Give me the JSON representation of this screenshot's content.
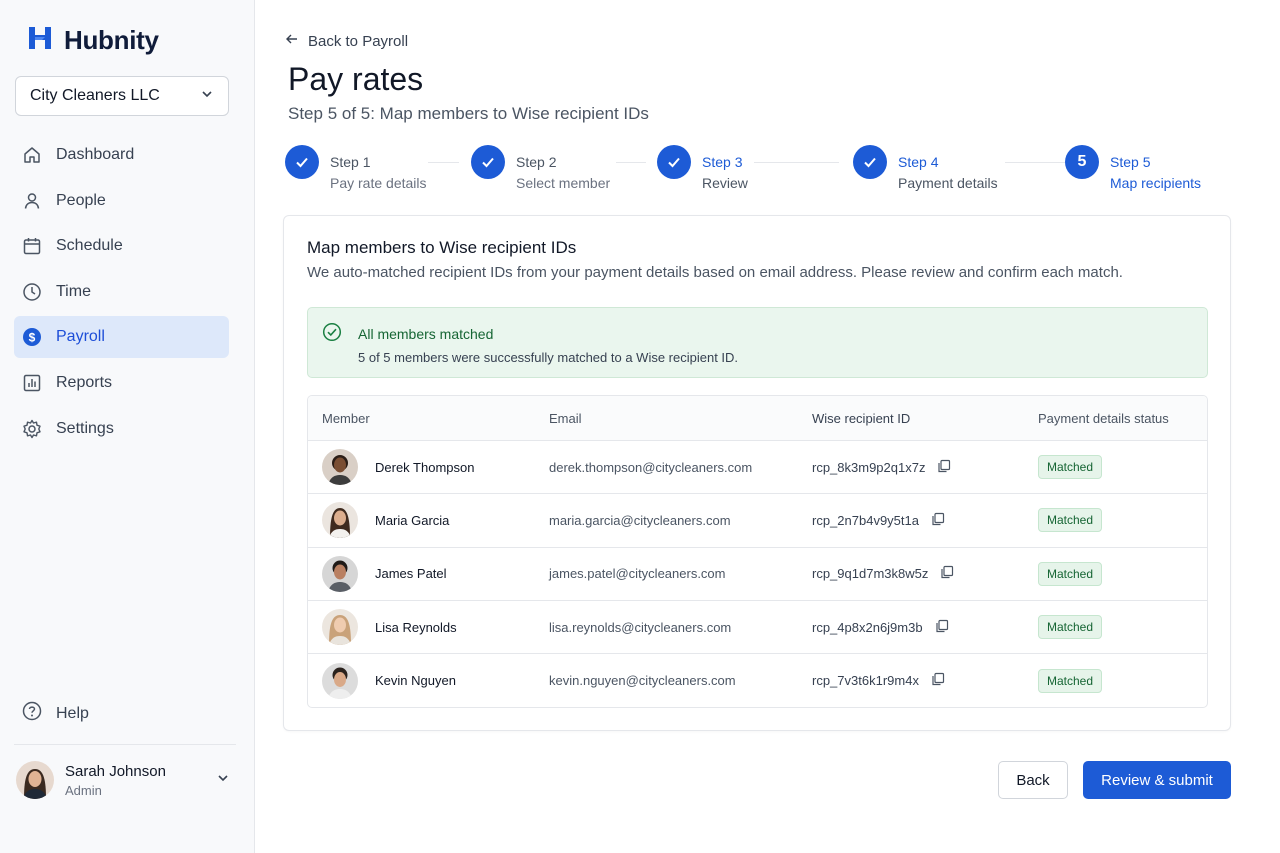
{
  "app": {
    "name": "Hubnity",
    "organization": "City Cleaners LLC"
  },
  "sidebar": {
    "items": [
      {
        "label": "Dashboard",
        "icon": "home-icon"
      },
      {
        "label": "People",
        "icon": "person-icon"
      },
      {
        "label": "Schedule",
        "icon": "calendar-icon"
      },
      {
        "label": "Time",
        "icon": "clock-icon"
      },
      {
        "label": "Payroll",
        "icon": "dollar-icon",
        "active": true
      },
      {
        "label": "Reports",
        "icon": "chart-icon"
      },
      {
        "label": "Settings",
        "icon": "gear-icon"
      }
    ],
    "help_label": "Help",
    "user": {
      "name": "Sarah Johnson",
      "role": "Admin"
    }
  },
  "header": {
    "back_label": "Back to Payroll",
    "title": "Pay rates",
    "subtitle": "Step 5 of 5: Map members to Wise recipient IDs"
  },
  "steps": [
    {
      "title": "Step 1",
      "desc": "Pay rate details",
      "state": "complete"
    },
    {
      "title": "Step 2",
      "desc": "Select member",
      "state": "complete"
    },
    {
      "title": "Step 3",
      "desc": "Review",
      "state": "complete"
    },
    {
      "title": "Step 4",
      "desc": "Payment details",
      "state": "complete"
    },
    {
      "title": "Step 5",
      "number": "5",
      "desc": "Map recipients",
      "state": "current"
    }
  ],
  "card": {
    "title": "Map members to Wise recipient IDs",
    "description": "We auto-matched recipient IDs from your payment details based on email address. Please review and confirm each match."
  },
  "alert": {
    "title": "All members matched",
    "text": "5 of 5 members were successfully matched to a Wise recipient ID."
  },
  "table": {
    "columns": [
      "Member",
      "Email",
      "Wise recipient ID",
      "Payment details status"
    ],
    "rows": [
      {
        "name": "Derek Thompson",
        "email": "derek.thompson@citycleaners.com",
        "recipient_id": "rcp_8k3m9p2q1x7z",
        "status": "Matched"
      },
      {
        "name": "Maria Garcia",
        "email": "maria.garcia@citycleaners.com",
        "recipient_id": "rcp_2n7b4v9y5t1a",
        "status": "Matched"
      },
      {
        "name": "James Patel",
        "email": "james.patel@citycleaners.com",
        "recipient_id": "rcp_9q1d7m3k8w5z",
        "status": "Matched"
      },
      {
        "name": "Lisa Reynolds",
        "email": "lisa.reynolds@citycleaners.com",
        "recipient_id": "rcp_4p8x2n6j9m3b",
        "status": "Matched"
      },
      {
        "name": "Kevin Nguyen",
        "email": "kevin.nguyen@citycleaners.com",
        "recipient_id": "rcp_7v3t6k1r9m4x",
        "status": "Matched"
      }
    ]
  },
  "actions": {
    "back_label": "Back",
    "submit_label": "Review & submit"
  },
  "colors": {
    "accent": "#1d5bd6",
    "active_nav_bg": "#dde8fa",
    "success_bg": "#eaf6ee",
    "success_text": "#166534"
  }
}
